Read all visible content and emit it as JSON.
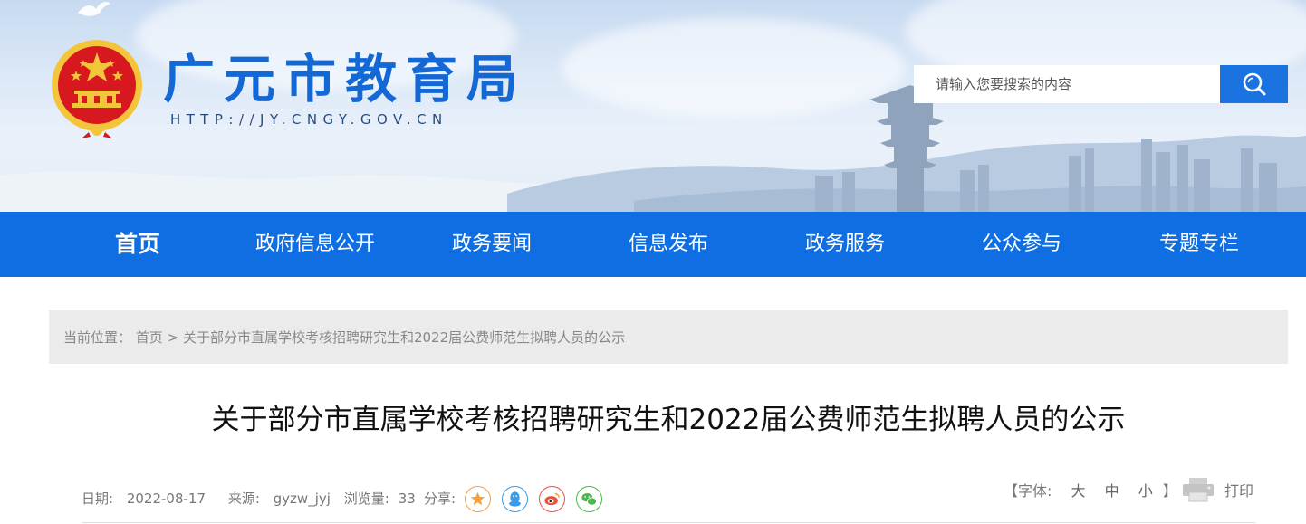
{
  "header": {
    "site_title": "广元市教育局",
    "site_url": "HTTP://JY.CNGY.GOV.CN",
    "search_placeholder": "请输入您要搜索的内容"
  },
  "nav": {
    "items": [
      {
        "label": "首页",
        "active": true
      },
      {
        "label": "政府信息公开"
      },
      {
        "label": "政务要闻"
      },
      {
        "label": "信息发布"
      },
      {
        "label": "政务服务"
      },
      {
        "label": "公众参与"
      },
      {
        "label": "专题专栏"
      }
    ]
  },
  "breadcrumb": {
    "prefix": "当前位置：",
    "home": "首页",
    "separator": ">",
    "current": "关于部分市直属学校考核招聘研究生和2022届公费师范生拟聘人员的公示"
  },
  "article": {
    "title": "关于部分市直属学校考核招聘研究生和2022届公费师范生拟聘人员的公示",
    "date_label": "日期:",
    "date": "2022-08-17",
    "source_label": "来源:",
    "source": "gyzw_jyj",
    "views_label": "浏览量:",
    "views": "33",
    "share_label": "分享:",
    "share_icons": [
      "favorite-star-icon",
      "qq-icon",
      "weibo-icon",
      "wechat-icon"
    ],
    "font_label_open": "【字体:",
    "font_sizes": [
      "大",
      "中",
      "小"
    ],
    "font_label_close": "】",
    "print_label": "打印"
  },
  "colors": {
    "brand_blue": "#1368d5",
    "nav_blue": "#0f6fe2",
    "search_button": "#1a73e0",
    "emblem_red": "#d7181f",
    "emblem_gold": "#f3c53a",
    "share_star": "#f3a13a",
    "share_qq": "#3b9be6",
    "share_weibo": "#e8543b",
    "share_wechat": "#4bb84b"
  }
}
